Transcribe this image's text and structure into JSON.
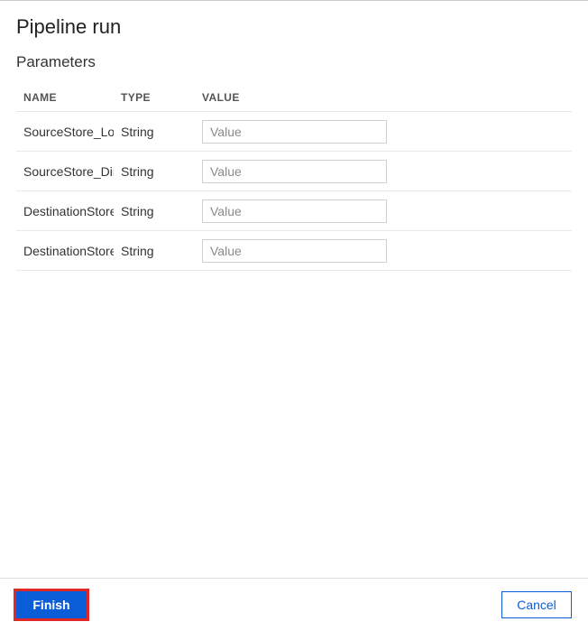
{
  "title": "Pipeline run",
  "section": "Parameters",
  "columns": {
    "name": "NAME",
    "type": "TYPE",
    "value": "VALUE"
  },
  "params": [
    {
      "name": "SourceStore_Loc",
      "type": "String",
      "placeholder": "Value",
      "value": ""
    },
    {
      "name": "SourceStore_Dire",
      "type": "String",
      "placeholder": "Value",
      "value": ""
    },
    {
      "name": "DestinationStore",
      "type": "String",
      "placeholder": "Value",
      "value": ""
    },
    {
      "name": "DestinationStore",
      "type": "String",
      "placeholder": "Value",
      "value": ""
    }
  ],
  "buttons": {
    "finish": "Finish",
    "cancel": "Cancel"
  }
}
